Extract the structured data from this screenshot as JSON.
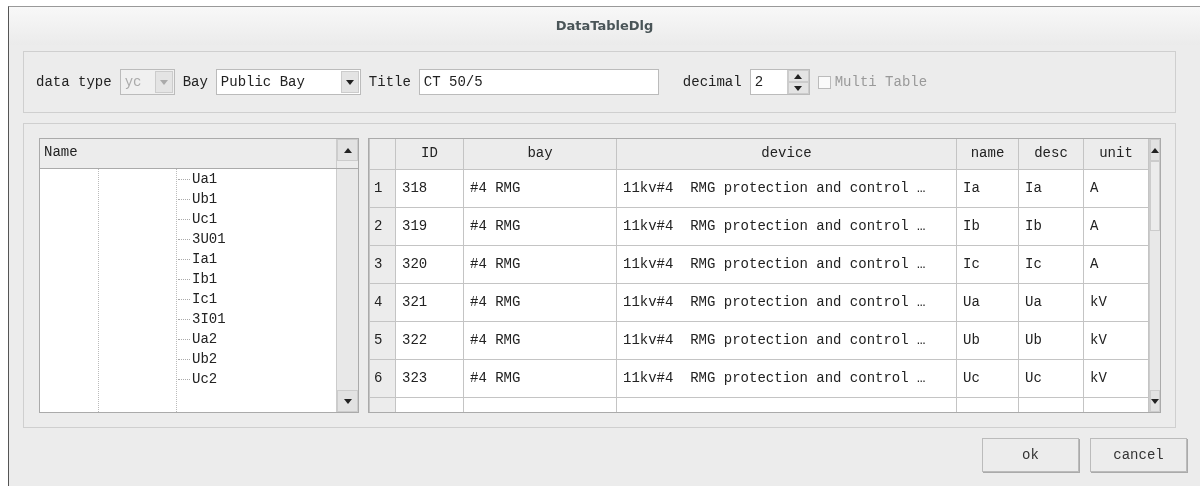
{
  "window": {
    "title": "DataTableDlg"
  },
  "toolbar": {
    "data_type": {
      "label": "data type",
      "value": "yc",
      "disabled": true
    },
    "bay": {
      "label": "Bay",
      "value": "Public Bay",
      "disabled": false
    },
    "title": {
      "label": "Title",
      "value": "CT 50/5"
    },
    "decimal": {
      "label": "decimal",
      "value": "2"
    },
    "multi_table": {
      "label": "Multi Table",
      "checked": false,
      "disabled": true
    }
  },
  "tree": {
    "header": "Name",
    "items": [
      {
        "label": "Ua1"
      },
      {
        "label": "Ub1"
      },
      {
        "label": "Uc1"
      },
      {
        "label": "3U01"
      },
      {
        "label": "Ia1"
      },
      {
        "label": "Ib1"
      },
      {
        "label": "Ic1"
      },
      {
        "label": "3I01"
      },
      {
        "label": "Ua2"
      },
      {
        "label": "Ub2"
      },
      {
        "label": "Uc2"
      }
    ]
  },
  "table": {
    "columns": [
      "ID",
      "bay",
      "device",
      "name",
      "desc",
      "unit"
    ],
    "rows": [
      {
        "index": "1",
        "cells": [
          "318",
          "#4 RMG",
          "11kv#4  RMG protection and control …",
          "Ia",
          "Ia",
          "A"
        ]
      },
      {
        "index": "2",
        "cells": [
          "319",
          "#4 RMG",
          "11kv#4  RMG protection and control …",
          "Ib",
          "Ib",
          "A"
        ]
      },
      {
        "index": "3",
        "cells": [
          "320",
          "#4 RMG",
          "11kv#4  RMG protection and control …",
          "Ic",
          "Ic",
          "A"
        ]
      },
      {
        "index": "4",
        "cells": [
          "321",
          "#4 RMG",
          "11kv#4  RMG protection and control …",
          "Ua",
          "Ua",
          "kV"
        ]
      },
      {
        "index": "5",
        "cells": [
          "322",
          "#4 RMG",
          "11kv#4  RMG protection and control …",
          "Ub",
          "Ub",
          "kV"
        ]
      },
      {
        "index": "6",
        "cells": [
          "323",
          "#4 RMG",
          "11kv#4  RMG protection and control …",
          "Uc",
          "Uc",
          "kV"
        ]
      }
    ]
  },
  "buttons": [
    {
      "label": "ok"
    },
    {
      "label": "cancel"
    }
  ]
}
